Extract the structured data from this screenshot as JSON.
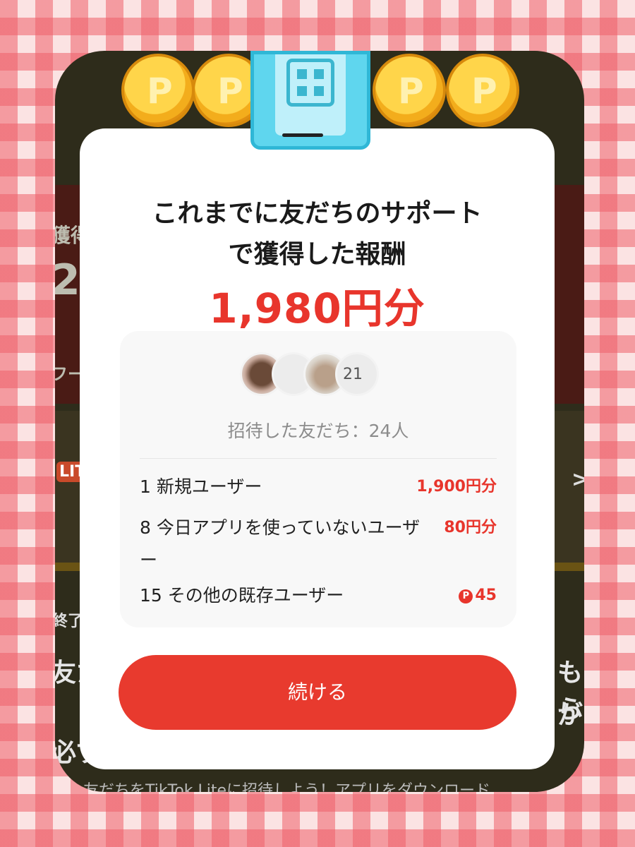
{
  "background": {
    "lines": [
      "獲得",
      "2",
      "フー",
      "終了",
      "友た",
      "もら",
      "が",
      "必ず",
      "友だちをTikTok Liteに招待しよう！アプリをダウンロード"
    ],
    "badge": "LITE",
    "chevron": ">"
  },
  "dialog": {
    "title_line1": "これまでに友だちのサポート",
    "title_line2": "で獲得した報酬",
    "amount": "1,980円分",
    "avatar_extra_count": "21",
    "invited_text": "招待した友だち：24人",
    "rows": [
      {
        "label": "1 新規ユーザー",
        "value": "1,900円分"
      },
      {
        "label": "8 今日アプリを使っていないユーザー",
        "value": "80円分"
      },
      {
        "label": "15 その他の既存ユーザー",
        "value": "45",
        "icon": "points-icon",
        "icon_glyph": "P"
      }
    ],
    "continue_label": "続ける"
  },
  "colors": {
    "accent": "#e8352c",
    "button": "#e83a2e",
    "checker": "#ee606a"
  }
}
